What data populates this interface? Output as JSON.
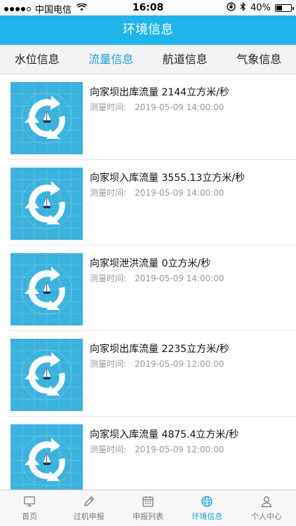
{
  "status": {
    "carrier": "中国电信",
    "time": "16:08",
    "battery": "40%",
    "battery_level": 0.4
  },
  "nav": {
    "title": "环境信息"
  },
  "tabs": [
    {
      "label": "水位信息"
    },
    {
      "label": "流量信息"
    },
    {
      "label": "航道信息"
    },
    {
      "label": "气象信息"
    }
  ],
  "active_tab": 1,
  "list": {
    "time_label": "测量时间:",
    "items": [
      {
        "title": "向家坝出库流量  2144立方米/秒",
        "time": "2019-05-09 14:00:00"
      },
      {
        "title": "向家坝入库流量  3555.13立方米/秒",
        "time": "2019-05-09 14:00:00"
      },
      {
        "title": "向家坝泄洪流量  0立方米/秒",
        "time": "2019-05-09 14:00:00"
      },
      {
        "title": "向家坝出库流量  2235立方米/秒",
        "time": "2019-05-09 12:00:00"
      },
      {
        "title": "向家坝入库流量  4875.4立方米/秒",
        "time": "2019-05-09 12:00:00"
      }
    ]
  },
  "tabbar": [
    {
      "label": "首页",
      "icon": "monitor-icon"
    },
    {
      "label": "过机申报",
      "icon": "pencil-icon"
    },
    {
      "label": "申报列表",
      "icon": "calendar-icon"
    },
    {
      "label": "环境信息",
      "icon": "globe-icon"
    },
    {
      "label": "个人中心",
      "icon": "person-icon"
    }
  ],
  "colors": {
    "nav_bg": "#1fb5ec",
    "accent": "#1a9ee6",
    "thumb_bg": "#3ab2dd"
  }
}
